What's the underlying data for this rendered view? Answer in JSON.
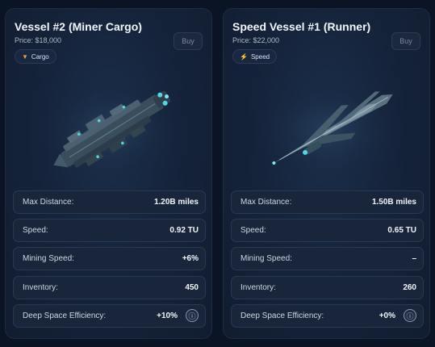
{
  "cards": [
    {
      "title": "Vessel #2 (Miner Cargo)",
      "price": "Price: $18,000",
      "tag": {
        "label": "Cargo",
        "icon": "funnel-icon"
      },
      "buy_label": "Buy",
      "stats": [
        {
          "label": "Max Distance:",
          "value": "1.20B miles"
        },
        {
          "label": "Speed:",
          "value": "0.92 TU"
        },
        {
          "label": "Mining Speed:",
          "value": "+6%"
        },
        {
          "label": "Inventory:",
          "value": "450"
        },
        {
          "label": "Deep Space Efficiency:",
          "value": "+10%",
          "info_icon": "ⓘ"
        }
      ]
    },
    {
      "title": "Speed Vessel #1 (Runner)",
      "price": "Price: $22,000",
      "tag": {
        "label": "Speed",
        "icon": "lightning-icon"
      },
      "buy_label": "Buy",
      "stats": [
        {
          "label": "Max Distance:",
          "value": "1.50B miles"
        },
        {
          "label": "Speed:",
          "value": "0.65 TU"
        },
        {
          "label": "Mining Speed:",
          "value": "–"
        },
        {
          "label": "Inventory:",
          "value": "260"
        },
        {
          "label": "Deep Space Efficiency:",
          "value": "+0%",
          "info_icon": "ⓘ"
        }
      ]
    }
  ],
  "colors": {
    "background": "#0b1424",
    "card": "#15243b",
    "tag_icon": "#e0a040",
    "ship_glow": "#4fd6e0"
  }
}
